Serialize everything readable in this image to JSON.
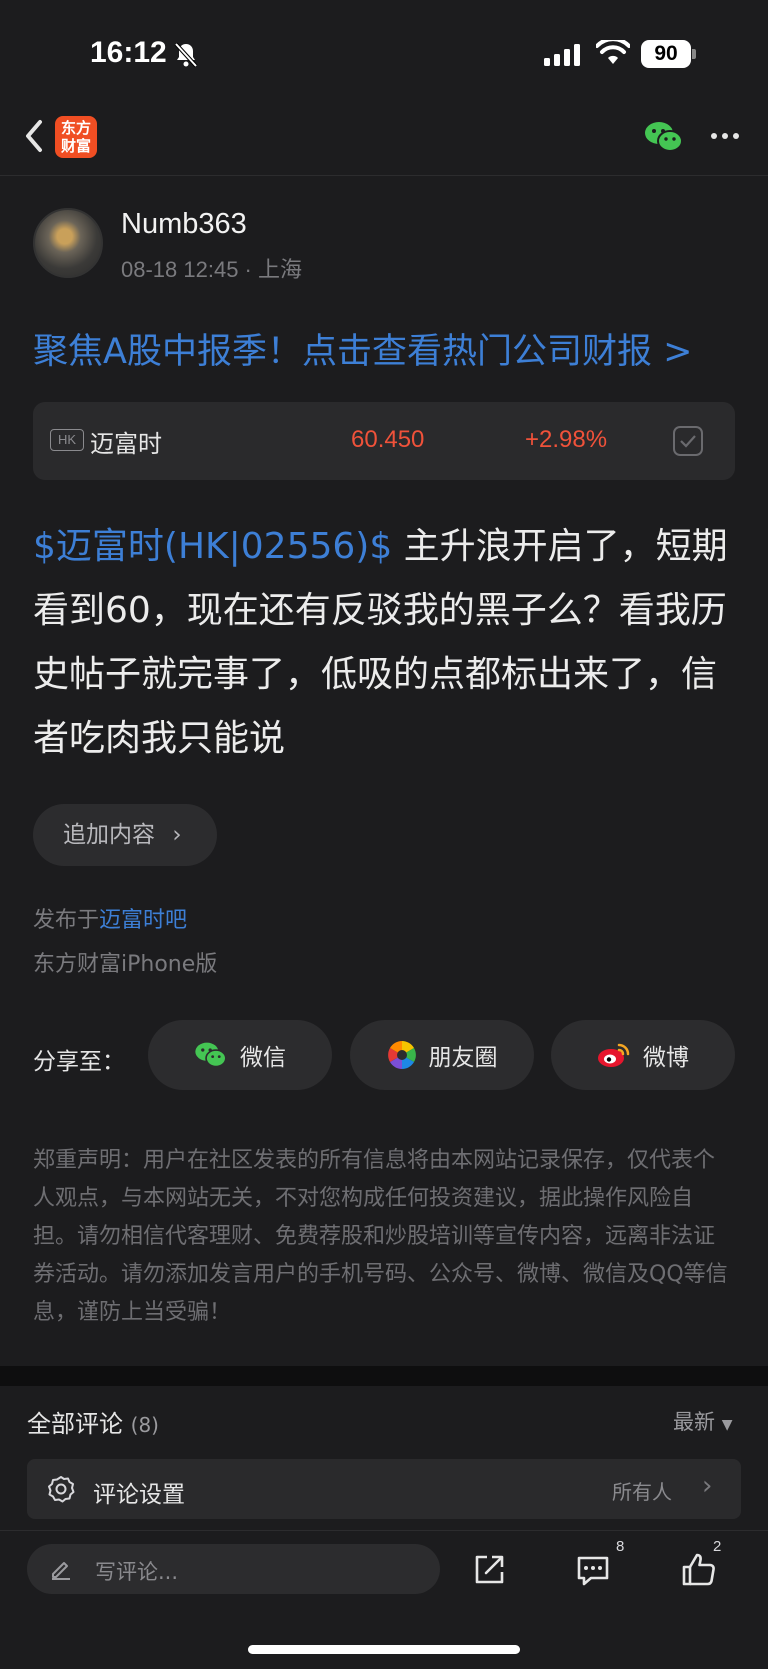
{
  "status_bar": {
    "time": "16:12",
    "battery": "90"
  },
  "nav": {
    "logo_text_line1": "东方",
    "logo_text_line2": "财富"
  },
  "post": {
    "author": "Numb363",
    "meta": "08-18 12:45 · 上海",
    "promo": "聚焦A股中报季！点击查看热门公司财报 >",
    "stock": {
      "market": "HK",
      "name": "迈富时",
      "price": "60.450",
      "change": "+2.98%"
    },
    "stock_link": "$迈富时(HK|02556)$",
    "body_text": "  主升浪开启了，短期看到60，现在还有反驳我的黑子么？看我历史帖子就完事了，低吸的点都标出来了，信者吃肉我只能说",
    "add_content": "追加内容",
    "published_prefix": "发布于",
    "published_bar": "迈富时吧",
    "client": "东方财富iPhone版"
  },
  "share": {
    "label": "分享至：",
    "buttons": [
      {
        "label": "微信",
        "icon": "wechat-icon"
      },
      {
        "label": "朋友圈",
        "icon": "moments-icon"
      },
      {
        "label": "微博",
        "icon": "weibo-icon"
      }
    ]
  },
  "disclaimer": "郑重声明：用户在社区发表的所有信息将由本网站记录保存，仅代表个人观点，与本网站无关，不对您构成任何投资建议，据此操作风险自担。请勿相信代客理财、免费荐股和炒股培训等宣传内容，远离非法证券活动。请勿添加发言用户的手机号码、公众号、微博、微信及QQ等信息，谨防上当受骗！",
  "comments": {
    "title": "全部评论",
    "count": "(8)",
    "sort": "最新",
    "settings_label": "评论设置",
    "settings_value": "所有人"
  },
  "bottom_bar": {
    "write_placeholder": "写评论...",
    "comment_count": "8",
    "like_count": "2"
  },
  "colors": {
    "accent_blue": "#3d7fd6",
    "up_red": "#f0523a",
    "background": "#1c1c1e"
  }
}
